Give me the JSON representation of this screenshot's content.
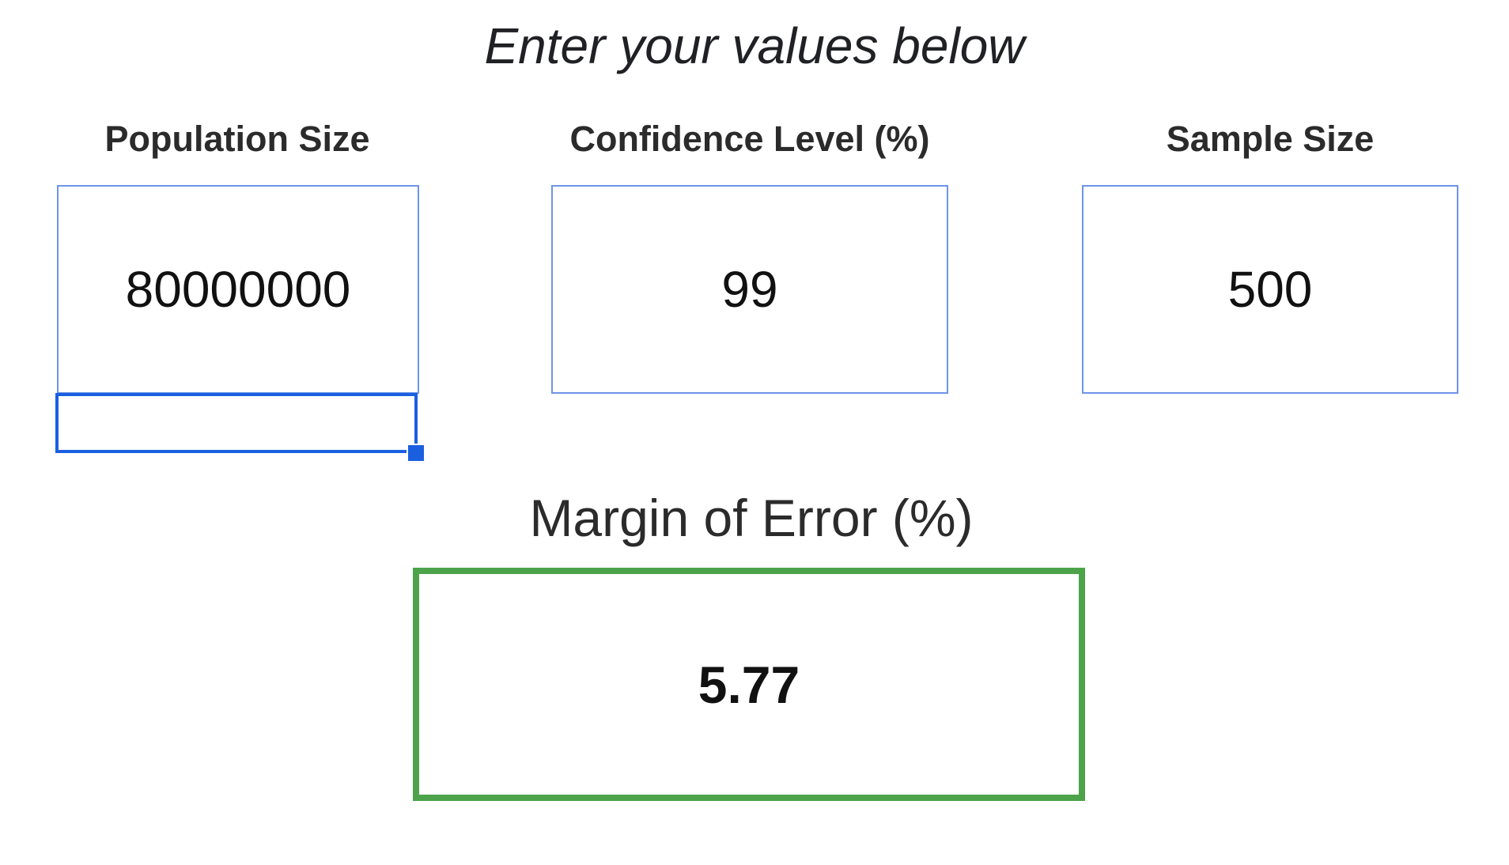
{
  "heading": "Enter your values below",
  "inputs": {
    "population": {
      "label": "Population Size",
      "value": "80000000"
    },
    "confidence": {
      "label": "Confidence Level (%)",
      "value": "99"
    },
    "sample": {
      "label": "Sample Size",
      "value": "500"
    }
  },
  "selected_cell": {
    "value": ""
  },
  "result": {
    "label": "Margin of Error (%)",
    "value": "5.77"
  },
  "colors": {
    "input_border": "#6e94e8",
    "selection": "#1a5fe0",
    "result_border": "#4ca34a"
  }
}
